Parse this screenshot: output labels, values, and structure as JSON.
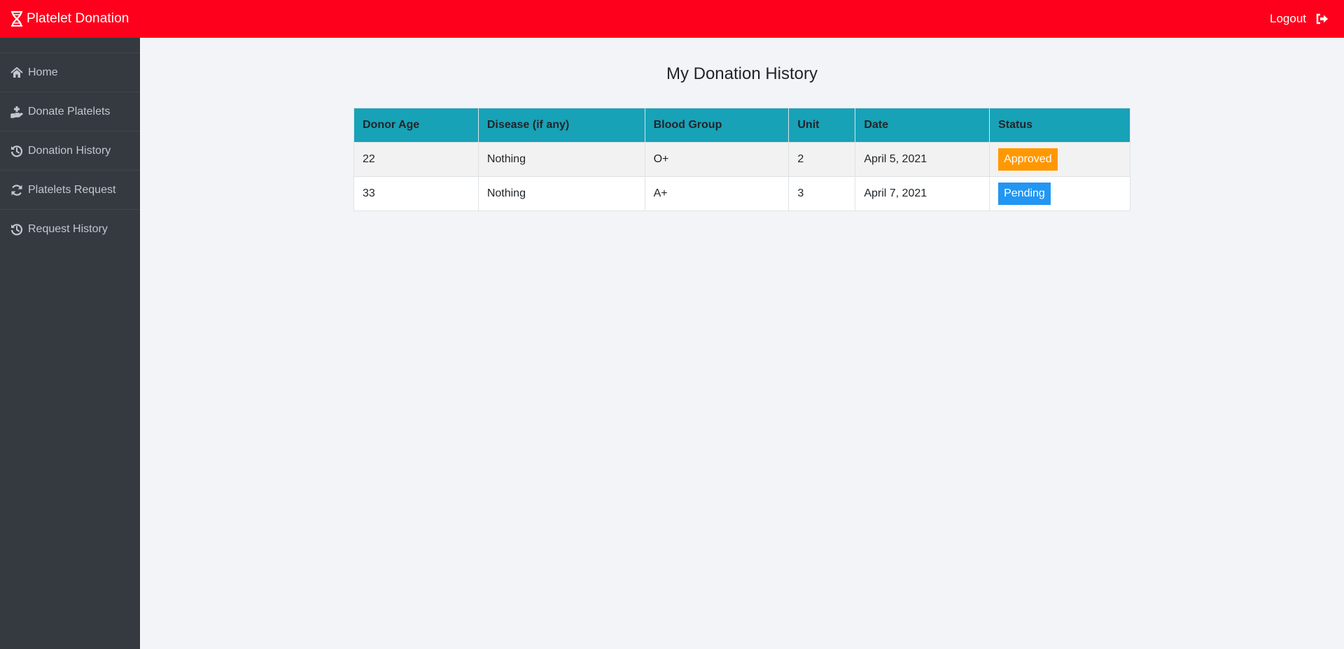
{
  "app": {
    "title": "Platelet Donation",
    "brand_icon": "dna-icon",
    "accent_color": "#ff001c"
  },
  "header": {
    "logout_label": "Logout",
    "logout_icon": "sign-out-icon"
  },
  "sidebar": {
    "items": [
      {
        "label": "Home",
        "icon": "home-icon"
      },
      {
        "label": "Donate Platelets",
        "icon": "hand-holding-medical-icon"
      },
      {
        "label": "Donation History",
        "icon": "history-icon"
      },
      {
        "label": "Platelets Request",
        "icon": "sync-icon"
      },
      {
        "label": "Request History",
        "icon": "history-icon"
      }
    ]
  },
  "main": {
    "title": "My Donation History",
    "table": {
      "columns": [
        "Donor Age",
        "Disease (if any)",
        "Blood Group",
        "Unit",
        "Date",
        "Status"
      ],
      "rows": [
        {
          "age": "22",
          "disease": "Nothing",
          "blood_group": "O+",
          "unit": "2",
          "date": "April 5, 2021",
          "status": "Approved"
        },
        {
          "age": "33",
          "disease": "Nothing",
          "blood_group": "A+",
          "unit": "3",
          "date": "April 7, 2021",
          "status": "Pending"
        }
      ]
    },
    "status_colors": {
      "approved": "#ff9800",
      "pending": "#2196f3"
    }
  }
}
